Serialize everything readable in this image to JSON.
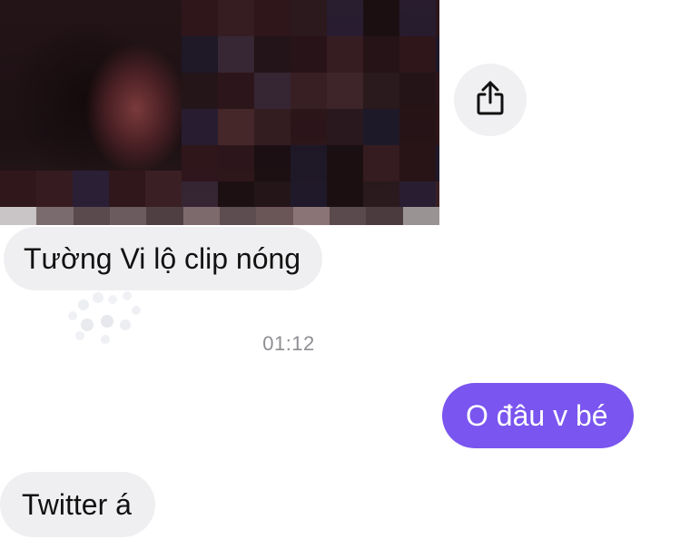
{
  "conversation": {
    "messages": [
      {
        "sender": "other",
        "type": "media",
        "description_icon": "censored-video-thumbnail"
      },
      {
        "sender": "other",
        "type": "text",
        "text": "Tường Vi lộ clip nóng"
      },
      {
        "sender": "self",
        "type": "text",
        "text": "O đâu v bé"
      },
      {
        "sender": "other",
        "type": "text",
        "text": "Twitter á"
      }
    ],
    "timestamp": "01:12"
  },
  "actions": {
    "share_icon": "share-icon"
  },
  "colors": {
    "outgoing_bubble": "#7a55ef",
    "incoming_bubble": "#efeff1",
    "timestamp_text": "#8e8e93",
    "share_button_bg": "#f0f0f2"
  }
}
